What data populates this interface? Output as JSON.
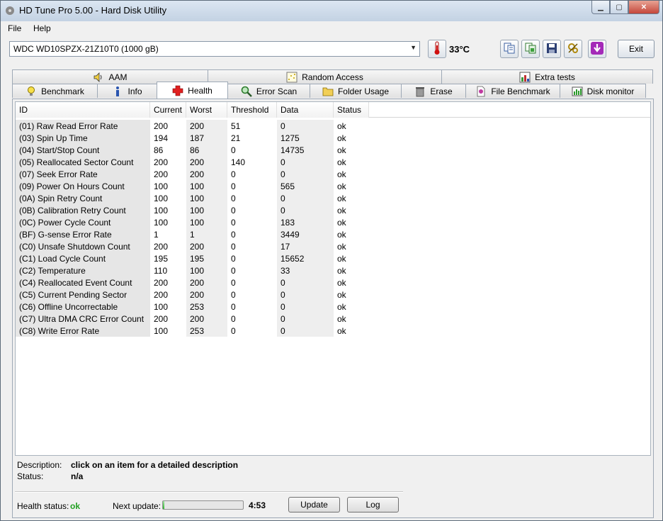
{
  "window": {
    "title": "HD Tune Pro 5.00 - Hard Disk Utility"
  },
  "menu": {
    "file": "File",
    "help": "Help"
  },
  "toolbar": {
    "drive": "WDC WD10SPZX-21Z10T0 (1000 gB)",
    "temperature": "33°C",
    "exit_label": "Exit",
    "icons": [
      "thermometer-icon",
      "copy-text-icon",
      "copy-image-icon",
      "save-icon",
      "options-icon",
      "download-icon"
    ]
  },
  "tabs_top": [
    {
      "label": "AAM",
      "icon": "speaker-icon"
    },
    {
      "label": "Random Access",
      "icon": "scatter-icon"
    },
    {
      "label": "Extra tests",
      "icon": "chart-icon"
    }
  ],
  "tabs_bottom": [
    {
      "label": "Benchmark",
      "icon": "lightbulb-icon"
    },
    {
      "label": "Info",
      "icon": "info-icon"
    },
    {
      "label": "Health",
      "icon": "cross-icon",
      "active": true
    },
    {
      "label": "Error Scan",
      "icon": "magnifier-icon"
    },
    {
      "label": "Folder Usage",
      "icon": "folder-icon"
    },
    {
      "label": "Erase",
      "icon": "trash-icon"
    },
    {
      "label": "File Benchmark",
      "icon": "file-icon"
    },
    {
      "label": "Disk monitor",
      "icon": "monitor-icon"
    }
  ],
  "table": {
    "columns": [
      "ID",
      "Current",
      "Worst",
      "Threshold",
      "Data",
      "Status"
    ],
    "rows": [
      [
        "(01) Raw Read Error Rate",
        "200",
        "200",
        "51",
        "0",
        "ok"
      ],
      [
        "(03) Spin Up Time",
        "194",
        "187",
        "21",
        "1275",
        "ok"
      ],
      [
        "(04) Start/Stop Count",
        "86",
        "86",
        "0",
        "14735",
        "ok"
      ],
      [
        "(05) Reallocated Sector Count",
        "200",
        "200",
        "140",
        "0",
        "ok"
      ],
      [
        "(07) Seek Error Rate",
        "200",
        "200",
        "0",
        "0",
        "ok"
      ],
      [
        "(09) Power On Hours Count",
        "100",
        "100",
        "0",
        "565",
        "ok"
      ],
      [
        "(0A) Spin Retry Count",
        "100",
        "100",
        "0",
        "0",
        "ok"
      ],
      [
        "(0B) Calibration Retry Count",
        "100",
        "100",
        "0",
        "0",
        "ok"
      ],
      [
        "(0C) Power Cycle Count",
        "100",
        "100",
        "0",
        "183",
        "ok"
      ],
      [
        "(BF) G-sense Error Rate",
        "1",
        "1",
        "0",
        "3449",
        "ok"
      ],
      [
        "(C0) Unsafe Shutdown Count",
        "200",
        "200",
        "0",
        "17",
        "ok"
      ],
      [
        "(C1) Load Cycle Count",
        "195",
        "195",
        "0",
        "15652",
        "ok"
      ],
      [
        "(C2) Temperature",
        "110",
        "100",
        "0",
        "33",
        "ok"
      ],
      [
        "(C4) Reallocated Event Count",
        "200",
        "200",
        "0",
        "0",
        "ok"
      ],
      [
        "(C5) Current Pending Sector",
        "200",
        "200",
        "0",
        "0",
        "ok"
      ],
      [
        "(C6) Offline Uncorrectable",
        "100",
        "253",
        "0",
        "0",
        "ok"
      ],
      [
        "(C7) Ultra DMA CRC Error Count",
        "200",
        "200",
        "0",
        "0",
        "ok"
      ],
      [
        "(C8) Write Error Rate",
        "100",
        "253",
        "0",
        "0",
        "ok"
      ]
    ]
  },
  "description": {
    "label": "Description:",
    "value": "click on an item for a detailed description",
    "status_label": "Status:",
    "status_value": "n/a"
  },
  "footer": {
    "health_label": "Health status:",
    "health_value": "ok",
    "next_update_label": "Next update:",
    "next_update_time": "4:53",
    "progress": 0.02,
    "update_button": "Update",
    "log_button": "Log"
  },
  "colors": {
    "health_ok": "#22a022",
    "progress_fill": "#2fb52f"
  }
}
